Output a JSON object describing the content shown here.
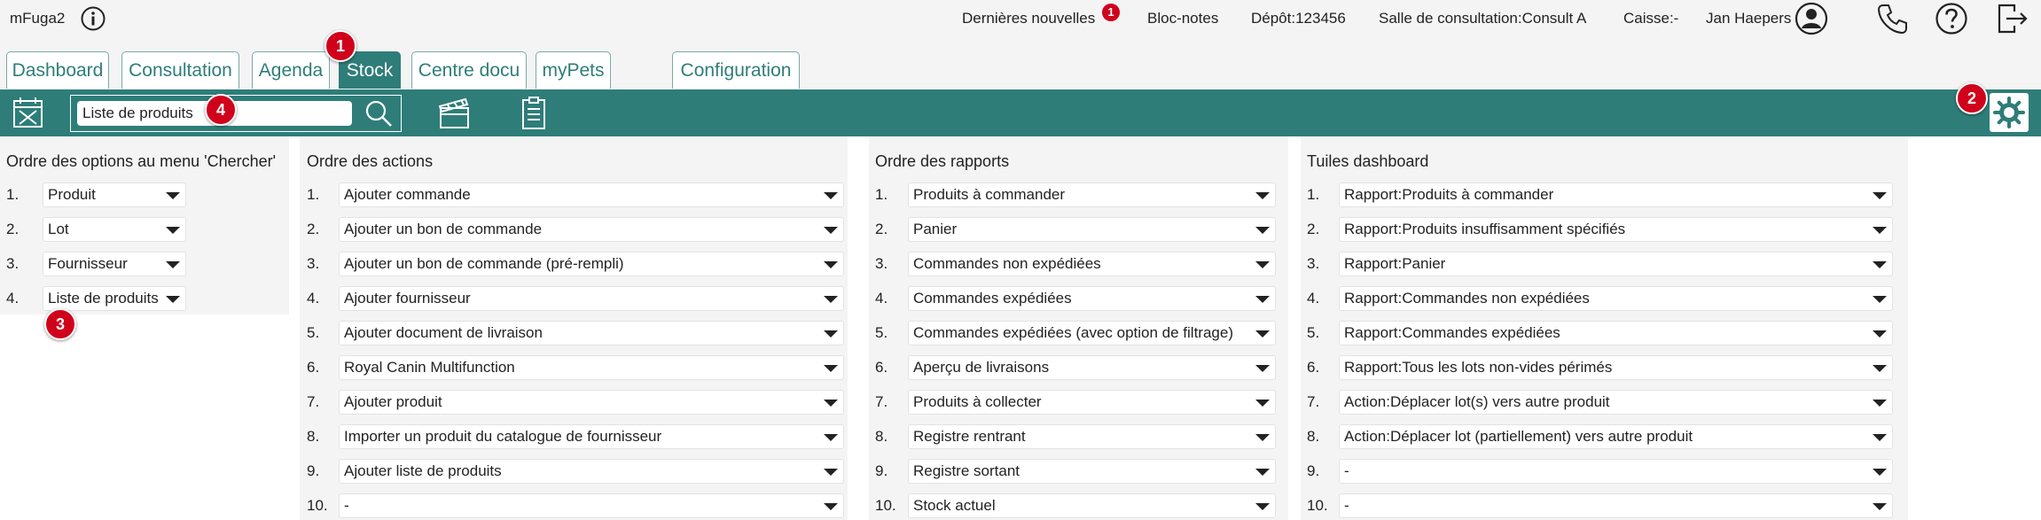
{
  "app": {
    "name": "mFuga2"
  },
  "header": {
    "news_label": "Dernières nouvelles",
    "news_badge": "1",
    "notes_label": "Bloc-notes",
    "depot_label": "Dépôt:123456",
    "room_label": "Salle de consultation:Consult A",
    "till_label": "Caisse:-",
    "user_name": "Jan Haepers"
  },
  "tabs": [
    "Dashboard",
    "Consultation",
    "Agenda",
    "Stock",
    "Centre docu",
    "myPets",
    "Configuration"
  ],
  "active_tab": "Stock",
  "search": {
    "value": "Liste de produits"
  },
  "markers": [
    "1",
    "2",
    "3",
    "4"
  ],
  "columns": {
    "search_menu": {
      "title": "Ordre des options au menu 'Chercher'",
      "items": [
        "Produit",
        "Lot",
        "Fournisseur",
        "Liste de produits"
      ]
    },
    "actions": {
      "title": "Ordre des actions",
      "items": [
        "Ajouter commande",
        "Ajouter un bon de commande",
        "Ajouter un bon de commande (pré-rempli)",
        "Ajouter fournisseur",
        "Ajouter document de livraison",
        "Royal Canin Multifunction",
        "Ajouter produit",
        "Importer un produit du catalogue de fournisseur",
        "Ajouter liste de produits",
        "-"
      ]
    },
    "reports": {
      "title": "Ordre des rapports",
      "items": [
        "Produits à commander",
        "Panier",
        "Commandes non expédiées",
        "Commandes expédiées",
        "Commandes expédiées (avec option de filtrage)",
        "Aperçu de livraisons",
        "Produits à collecter",
        "Registre rentrant",
        "Registre sortant",
        "Stock actuel"
      ]
    },
    "tiles": {
      "title": "Tuiles dashboard",
      "items": [
        "Rapport:Produits à commander",
        "Rapport:Produits insuffisamment spécifiés",
        "Rapport:Panier",
        "Rapport:Commandes non expédiées",
        "Rapport:Commandes expédiées",
        "Rapport:Tous les lots non-vides périmés",
        "Action:Déplacer lot(s) vers autre produit",
        "Action:Déplacer lot (partiellement) vers autre produit",
        "-",
        "-"
      ]
    }
  },
  "colors": {
    "accent": "#2e7d79",
    "badge": "#d0021b",
    "panel": "#f4f4f4"
  },
  "icons": [
    "info-icon",
    "user-icon",
    "phone-icon",
    "help-icon",
    "logout-icon",
    "calendar-icon",
    "search-icon",
    "clapperboard-icon",
    "clipboard-icon",
    "gear-icon",
    "dropdown-arrow-icon"
  ]
}
